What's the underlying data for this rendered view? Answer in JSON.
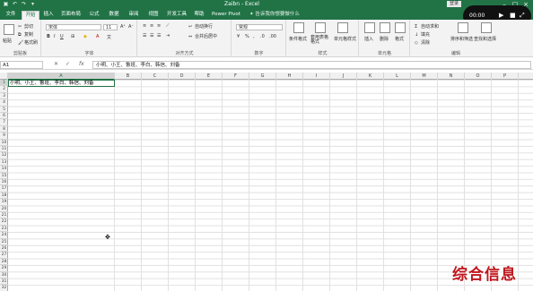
{
  "titlebar": {
    "title": "Zaibn - Excel",
    "signin": "登录",
    "colors": {
      "accent": "#217346"
    },
    "qat_icons": [
      "save-icon",
      "undo-icon",
      "redo-icon",
      "customize-icon"
    ]
  },
  "tabs": [
    {
      "label": "文件",
      "active": false
    },
    {
      "label": "开始",
      "active": true
    },
    {
      "label": "插入",
      "active": false
    },
    {
      "label": "页面布局",
      "active": false
    },
    {
      "label": "公式",
      "active": false
    },
    {
      "label": "数据",
      "active": false
    },
    {
      "label": "审阅",
      "active": false
    },
    {
      "label": "视图",
      "active": false
    },
    {
      "label": "开发工具",
      "active": false
    },
    {
      "label": "帮助",
      "active": false
    },
    {
      "label": "Power Pivot",
      "active": false
    }
  ],
  "tell_me": "告诉我你想要做什么",
  "video": {
    "time": "00:00"
  },
  "ribbon": {
    "clipboard": {
      "paste": "粘贴",
      "cut": "剪切",
      "copy": "复制",
      "format_painter": "格式刷",
      "label": "剪贴板"
    },
    "font": {
      "font_name": "宋体",
      "font_size": "11",
      "label": "字体"
    },
    "alignment": {
      "wrap": "自动换行",
      "merge": "合并后居中",
      "label": "对齐方式"
    },
    "number": {
      "format": "常规",
      "label": "数字"
    },
    "styles": {
      "conditional": "条件格式",
      "table": "套用表格格式",
      "cell_styles": "单元格样式",
      "label": "样式"
    },
    "cells": {
      "insert": "插入",
      "delete": "删除",
      "format": "格式",
      "label": "单元格"
    },
    "editing": {
      "autosum": "自动求和",
      "fill": "填充",
      "clear": "清除",
      "sort": "排序和筛选",
      "find": "查找和选择",
      "label": "编辑"
    }
  },
  "formula_bar": {
    "name_box": "A1",
    "fx": "fx",
    "content": "小明、小王、鲁班、李白、韩信、刘备"
  },
  "grid": {
    "columns": [
      "A",
      "B",
      "C",
      "D",
      "E",
      "F",
      "G",
      "H",
      "I",
      "J",
      "K",
      "L",
      "M",
      "N",
      "O",
      "P"
    ],
    "rows": [
      "1",
      "2",
      "3",
      "4",
      "5",
      "6",
      "7",
      "8",
      "9",
      "10",
      "11",
      "12",
      "13",
      "14",
      "15",
      "16",
      "17",
      "18",
      "19",
      "20",
      "21",
      "22",
      "23",
      "24",
      "25",
      "26",
      "27",
      "28",
      "29",
      "30",
      "31",
      "32"
    ],
    "selected_cell": "A1",
    "a1_value": "小明、小王、鲁班、李白、韩信、刘备"
  },
  "watermark": "综合信息"
}
